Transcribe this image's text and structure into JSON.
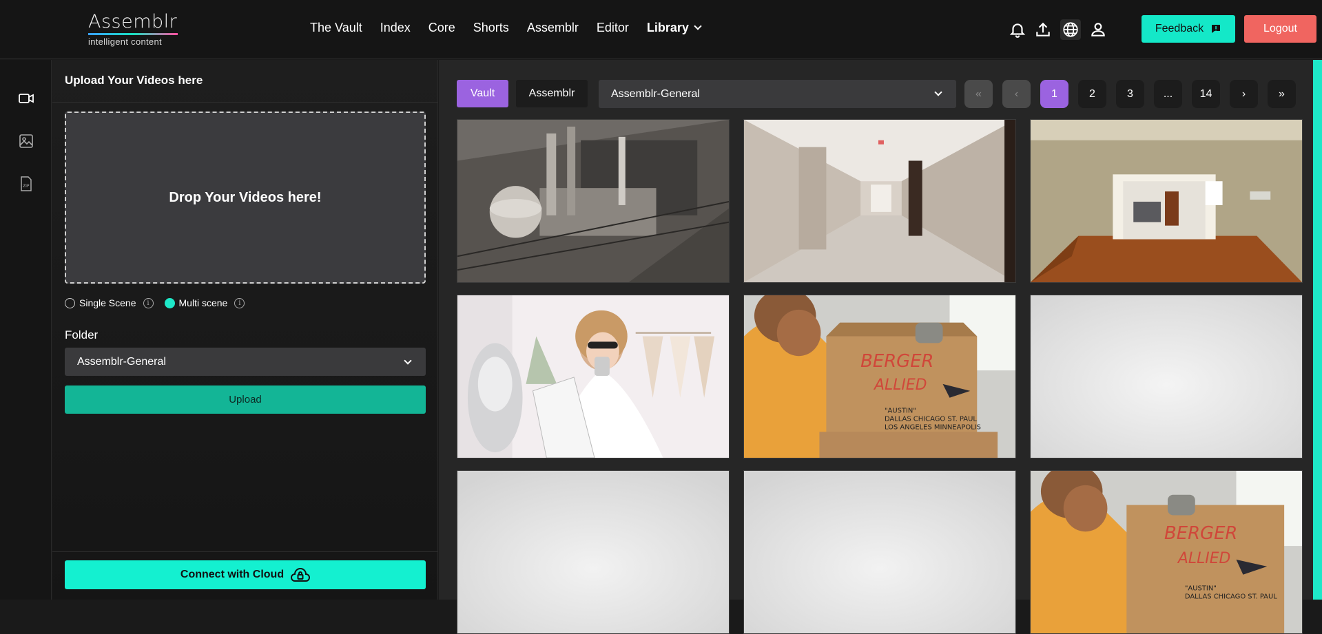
{
  "brand": {
    "name": "Assemblr",
    "tagline": "intelligent content"
  },
  "nav": {
    "items": [
      "The Vault",
      "Index",
      "Core",
      "Shorts",
      "Assemblr",
      "Editor"
    ],
    "library_label": "Library"
  },
  "header_icons": [
    "bell-icon",
    "upload-icon",
    "globe-icon",
    "user-icon"
  ],
  "header_buttons": {
    "feedback": "Feedback",
    "logout": "Logout"
  },
  "colors": {
    "accent_teal": "#14e8c8",
    "accent_purple": "#9b63e0",
    "logout_red": "#f06560",
    "upload_green": "#13b596"
  },
  "rail_icons": [
    "video-icon",
    "image-icon",
    "zip-icon"
  ],
  "upload_panel": {
    "title": "Upload Your Videos here",
    "dropzone_text": "Drop Your Videos here!",
    "scene_options": [
      {
        "label": "Single Scene",
        "selected": false
      },
      {
        "label": "Multi scene",
        "selected": true
      }
    ],
    "folder_label": "Folder",
    "folder_value": "Assemblr-General",
    "upload_button": "Upload",
    "cloud_button": "Connect with Cloud"
  },
  "main": {
    "tabs": [
      {
        "label": "Vault",
        "active": true
      },
      {
        "label": "Assemblr",
        "active": false
      }
    ],
    "folder_select": "Assemblr-General",
    "pagination": {
      "first": "«",
      "prev": "‹",
      "pages": [
        "1",
        "2",
        "3",
        "...",
        "14"
      ],
      "current": "1",
      "next": "›",
      "last": "»"
    },
    "thumbnails": [
      "industrial-plant-thumbnail",
      "hallway-thumbnail",
      "empty-room-thumbnail",
      "designer-drinking-thumbnail",
      "packing-box-thumbnail",
      "blank-thumbnail",
      "blank-thumbnail",
      "blank-thumbnail",
      "packing-box-thumbnail"
    ],
    "box_text": [
      "BERGER",
      "ALLIED",
      "\"AUSTIN\"",
      "DALLAS CHICAGO ST. PAUL",
      "LOS ANGELES MINNEAPOLIS"
    ]
  }
}
